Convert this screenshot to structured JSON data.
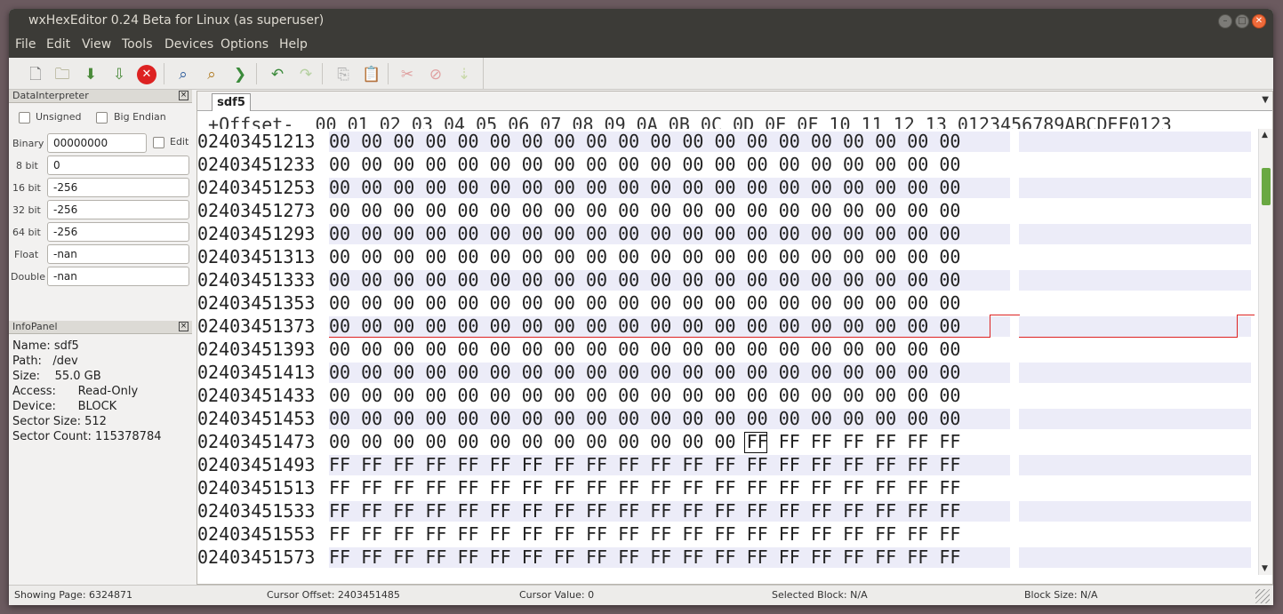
{
  "window": {
    "title": "wxHexEditor 0.24 Beta for Linux (as superuser)"
  },
  "menu": [
    "File",
    "Edit",
    "View",
    "Tools",
    "Devices",
    "Options",
    "Help"
  ],
  "toolbar_icons": [
    "new-file-icon",
    "open-folder-icon",
    "save-icon",
    "save-as-icon",
    "close-file-icon",
    "find-icon",
    "find-replace-icon",
    "goto-offset-icon",
    "undo-icon",
    "redo-icon",
    "copy-icon",
    "paste-icon",
    "cut-icon",
    "delete-icon",
    "insert-icon"
  ],
  "data_interpreter": {
    "title": "DataInterpreter",
    "unsigned_label": "Unsigned",
    "big_endian_label": "Big Endian",
    "edit_label": "Edit",
    "fields": [
      {
        "label": "Binary",
        "value": "00000000"
      },
      {
        "label": "8 bit",
        "value": "0"
      },
      {
        "label": "16 bit",
        "value": "-256"
      },
      {
        "label": "32 bit",
        "value": "-256"
      },
      {
        "label": "64 bit",
        "value": "-256"
      },
      {
        "label": "Float",
        "value": "-nan"
      },
      {
        "label": "Double",
        "value": "-nan"
      }
    ]
  },
  "info_panel": {
    "title": "InfoPanel",
    "lines": [
      "Name: sdf5",
      "Path:   /dev",
      "Size:    55.0 GB",
      "Access:      Read-Only",
      "Device:      BLOCK",
      "Sector Size: 512",
      "Sector Count: 115378784"
    ]
  },
  "editor": {
    "tab": "sdf5",
    "header": " +Offset-  00 01 02 03 04 05 06 07 08 09 0A 0B 0C 0D 0E 0F 10 11 12 13 0123456789ABCDEF0123",
    "rows": [
      {
        "offset": "02403451213",
        "hex": "00 00 00 00 00 00 00 00 00 00 00 00 00 00 00 00 00 00 00 00"
      },
      {
        "offset": "02403451233",
        "hex": "00 00 00 00 00 00 00 00 00 00 00 00 00 00 00 00 00 00 00 00"
      },
      {
        "offset": "02403451253",
        "hex": "00 00 00 00 00 00 00 00 00 00 00 00 00 00 00 00 00 00 00 00"
      },
      {
        "offset": "02403451273",
        "hex": "00 00 00 00 00 00 00 00 00 00 00 00 00 00 00 00 00 00 00 00"
      },
      {
        "offset": "02403451293",
        "hex": "00 00 00 00 00 00 00 00 00 00 00 00 00 00 00 00 00 00 00 00"
      },
      {
        "offset": "02403451313",
        "hex": "00 00 00 00 00 00 00 00 00 00 00 00 00 00 00 00 00 00 00 00"
      },
      {
        "offset": "02403451333",
        "hex": "00 00 00 00 00 00 00 00 00 00 00 00 00 00 00 00 00 00 00 00"
      },
      {
        "offset": "02403451353",
        "hex": "00 00 00 00 00 00 00 00 00 00 00 00 00 00 00 00 00 00 00 00"
      },
      {
        "offset": "02403451373",
        "hex": "00 00 00 00 00 00 00 00 00 00 00 00 00 00 00 00 00 00 00 00"
      },
      {
        "offset": "02403451393",
        "hex": "00 00 00 00 00 00 00 00 00 00 00 00 00 00 00 00 00 00 00 00"
      },
      {
        "offset": "02403451413",
        "hex": "00 00 00 00 00 00 00 00 00 00 00 00 00 00 00 00 00 00 00 00"
      },
      {
        "offset": "02403451433",
        "hex": "00 00 00 00 00 00 00 00 00 00 00 00 00 00 00 00 00 00 00 00"
      },
      {
        "offset": "02403451453",
        "hex": "00 00 00 00 00 00 00 00 00 00 00 00 00 00 00 00 00 00 00 00"
      },
      {
        "offset": "02403451473",
        "hex": "00 00 00 00 00 00 00 00 00 00 00 00 00 FF FF FF FF FF FF FF"
      },
      {
        "offset": "02403451493",
        "hex": "FF FF FF FF FF FF FF FF FF FF FF FF FF FF FF FF FF FF FF FF"
      },
      {
        "offset": "02403451513",
        "hex": "FF FF FF FF FF FF FF FF FF FF FF FF FF FF FF FF FF FF FF FF"
      },
      {
        "offset": "02403451533",
        "hex": "FF FF FF FF FF FF FF FF FF FF FF FF FF FF FF FF FF FF FF FF"
      },
      {
        "offset": "02403451553",
        "hex": "FF FF FF FF FF FF FF FF FF FF FF FF FF FF FF FF FF FF FF FF"
      },
      {
        "offset": "02403451573",
        "hex": "FF FF FF FF FF FF FF FF FF FF FF FF FF FF FF FF FF FF FF FF"
      }
    ]
  },
  "status": {
    "page": "Showing Page: 6324871",
    "cursor_offset": "Cursor Offset: 2403451485",
    "cursor_value": "Cursor Value: 0",
    "selected_block": "Selected Block: N/A",
    "block_size": "Block Size: N/A"
  }
}
